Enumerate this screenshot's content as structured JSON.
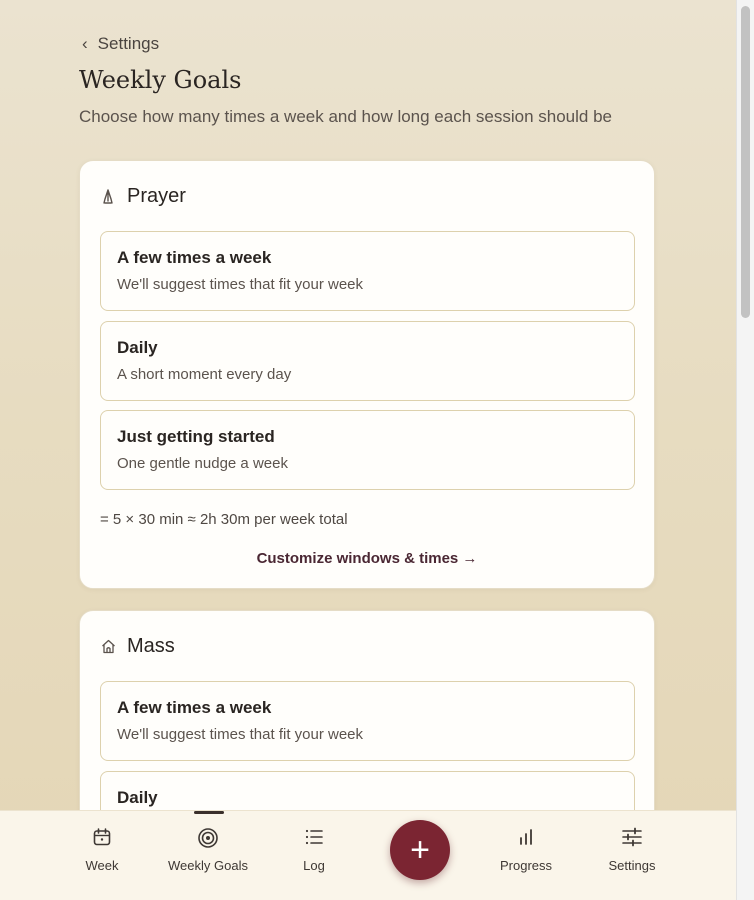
{
  "header": {
    "back_label": "Settings",
    "title": "Weekly Goals",
    "subtitle": "Choose how many times a week and how long each session should be"
  },
  "cards": [
    {
      "title": "Prayer",
      "icon": "prayer-hands-icon",
      "options": [
        {
          "title": "A few times a week",
          "desc": "We'll suggest times that fit your week"
        },
        {
          "title": "Daily",
          "desc": "A short moment every day"
        },
        {
          "title": "Just getting started",
          "desc": "One gentle nudge a week"
        }
      ],
      "total": "= 5 × 30 min ≈ 2h 30m per week total",
      "customize": "Customize windows & times →"
    },
    {
      "title": "Mass",
      "icon": "church-icon",
      "options": [
        {
          "title": "A few times a week",
          "desc": "We'll suggest times that fit your week"
        },
        {
          "title": "Daily",
          "desc": ""
        }
      ]
    }
  ],
  "nav": {
    "items": [
      {
        "label": "Week",
        "icon": "calendar-icon"
      },
      {
        "label": "Weekly Goals",
        "icon": "target-icon",
        "active": true
      },
      {
        "label": "Log",
        "icon": "list-icon"
      },
      {
        "label": "Progress",
        "icon": "bar-chart-icon"
      },
      {
        "label": "Settings",
        "icon": "sliders-icon"
      }
    ],
    "fab_label": "+"
  },
  "colors": {
    "accent": "#7b2532",
    "background": "#e9dfc9",
    "card": "#fffefb",
    "option_border": "#ddd1ad"
  }
}
